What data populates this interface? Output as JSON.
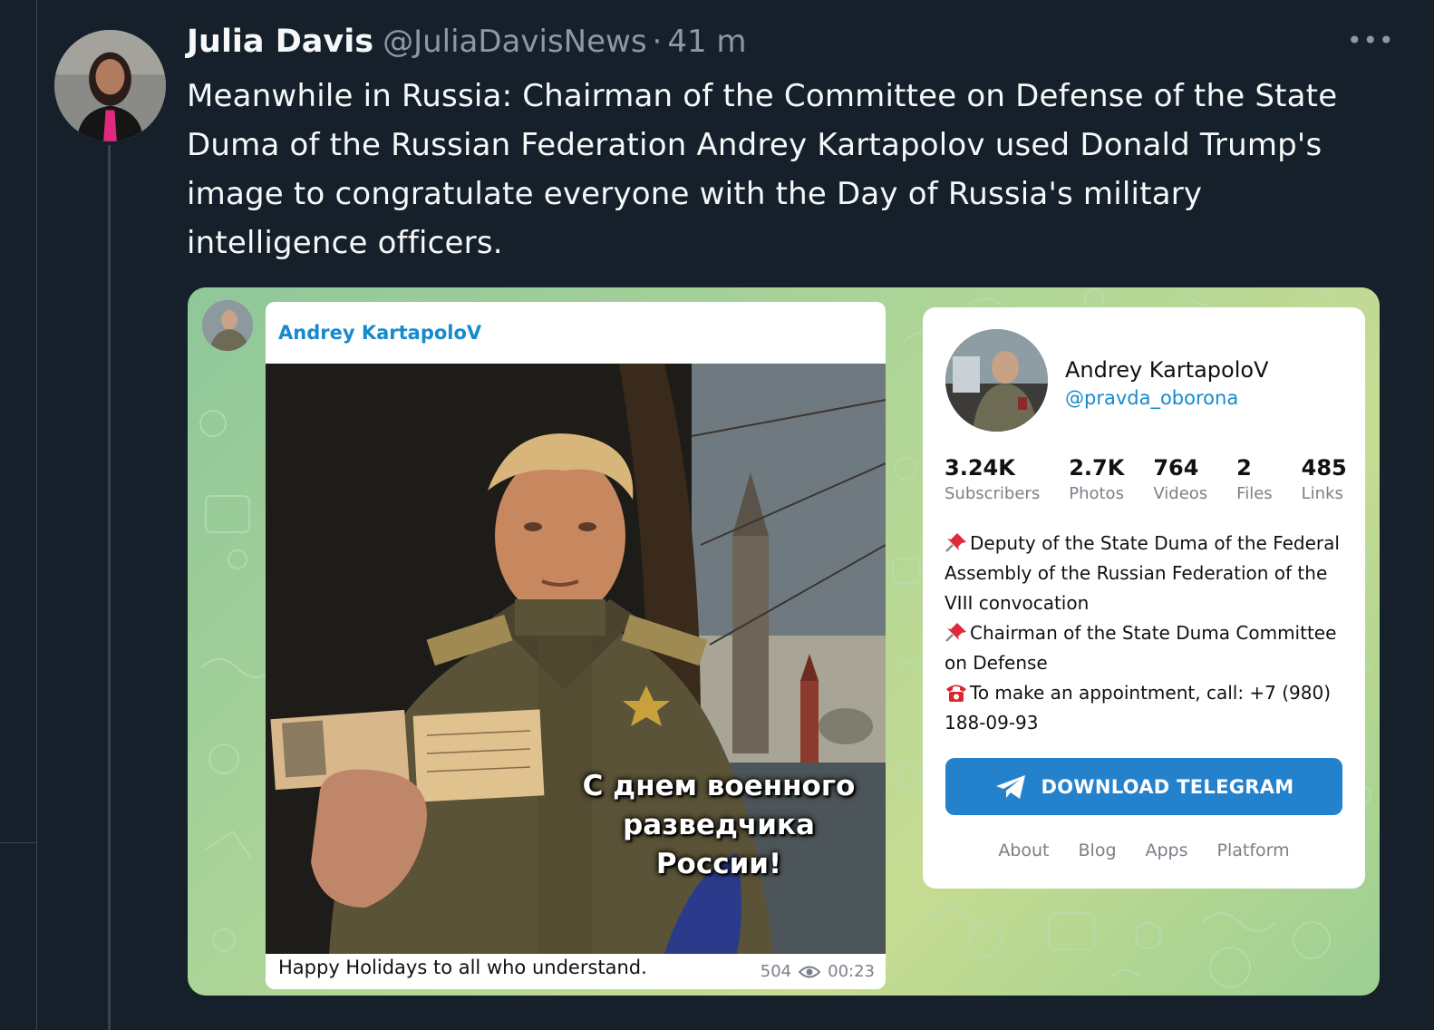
{
  "tweet": {
    "display_name": "Julia Davis",
    "handle": "@JuliaDavisNews",
    "separator": "·",
    "time": "41 m",
    "more_icon": "more-horizontal-icon",
    "text": "Meanwhile in Russia: Chairman of the Committee on Defense of the State Duma of the Russian Federation Andrey Kartapolov used Donald Trump's image to congratulate everyone with the Day of Russia's military intelligence officers."
  },
  "telegram_post": {
    "author": "Andrey KartapoloV",
    "image_overlay_text": "С днем военного разведчика России!",
    "caption": "Happy Holidays to all who understand.",
    "views": "504",
    "time": "00:23",
    "views_icon": "eye-icon"
  },
  "telegram_profile": {
    "name": "Andrey KartapoloV",
    "username": "@pravda_oborona",
    "stats": [
      {
        "value": "3.24K",
        "label": "Subscribers"
      },
      {
        "value": "2.7K",
        "label": "Photos"
      },
      {
        "value": "764",
        "label": "Videos"
      },
      {
        "value": "2",
        "label": "Files"
      },
      {
        "value": "485",
        "label": "Links"
      }
    ],
    "bio_lines": [
      "Deputy of the State Duma of the Federal Assembly of the Russian Federation of the VIII convocation",
      "Chairman of the State Duma Committee on Defense",
      "To make an appointment, call: +7 (980) 188-09-93"
    ],
    "download_button": "DOWNLOAD TELEGRAM",
    "footer_links": [
      "About",
      "Blog",
      "Apps",
      "Platform"
    ]
  },
  "colors": {
    "background": "#15202b",
    "text": "#f7f9f9",
    "muted": "#8b98a5",
    "telegram_blue": "#2481cc",
    "link_blue": "#168acd"
  }
}
